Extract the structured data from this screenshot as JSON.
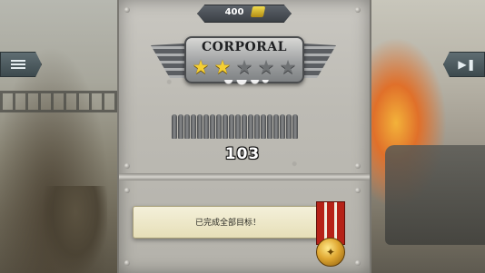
{
  "score": {
    "value": "400",
    "icon": "gold-bars-icon"
  },
  "rank": {
    "title": "CORPORAL",
    "stars_total": 5,
    "stars_earned": 2
  },
  "ammo": {
    "bullets_shown": 20
  },
  "shots": {
    "value": "103"
  },
  "nav": {
    "menu_icon": "menu-list-icon",
    "next_icon": "next-level-icon"
  },
  "objective": {
    "text": "已完成全部目标！"
  },
  "colors": {
    "panel": "#bdbbb4",
    "star_filled": "#f4cf33",
    "star_empty": "#6f7274",
    "ribbon_red": "#b62218",
    "medal_gold": "#e0a832"
  }
}
